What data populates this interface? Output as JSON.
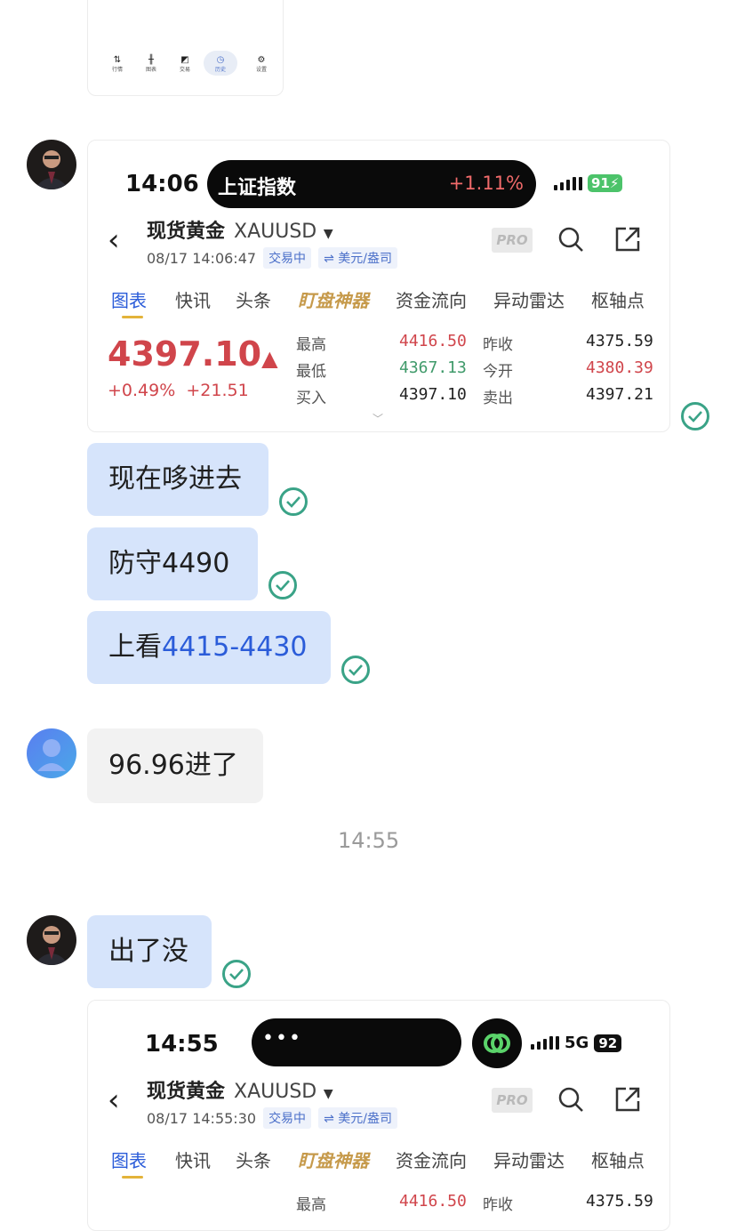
{
  "top_card": {
    "nav": [
      {
        "icon": "quotes-icon",
        "label": "行情"
      },
      {
        "icon": "candles-icon",
        "label": "图表"
      },
      {
        "icon": "trade-icon",
        "label": "交易"
      },
      {
        "icon": "history-icon",
        "label": "历史"
      },
      {
        "icon": "settings-icon",
        "label": "设置"
      }
    ]
  },
  "shot1": {
    "time": "14:06",
    "ticker_name": "上证指数",
    "ticker_change": "+1.11%",
    "battery": "91",
    "instrument": "现货黄金",
    "code": "XAUUSD",
    "datetime": "08/17 14:06:47",
    "status": "交易中",
    "currency": "⇌ 美元/盎司",
    "pro": "PRO",
    "tabs": [
      "图表",
      "快讯",
      "头条",
      "盯盘神器",
      "资金流向",
      "异动雷达",
      "枢轴点"
    ],
    "price": "4397.10",
    "change_pct": "+0.49%",
    "change_abs": "+21.51",
    "quotes": [
      {
        "label": "最高",
        "value": "4416.50",
        "label2": "昨收",
        "value2": "4375.59"
      },
      {
        "label": "最低",
        "value": "4367.13",
        "label2": "今开",
        "value2": "4380.39"
      },
      {
        "label": "买入",
        "value": "4397.10",
        "label2": "卖出",
        "value2": "4397.21"
      }
    ]
  },
  "messages": {
    "m1": "现在哆进去",
    "m2": "防守4490",
    "m3_prefix": "上看",
    "m3_range": "4415-4430",
    "m4": "96.96进了",
    "timestamp": "14:55",
    "m5": "出了没"
  },
  "shot2": {
    "time": "14:55",
    "network": "5G",
    "battery": "92",
    "instrument": "现货黄金",
    "code": "XAUUSD",
    "datetime": "08/17 14:55:30",
    "status": "交易中",
    "currency": "⇌ 美元/盎司",
    "pro": "PRO",
    "tabs": [
      "图表",
      "快讯",
      "头条",
      "盯盘神器",
      "资金流向",
      "异动雷达",
      "枢轴点"
    ],
    "quotes": [
      {
        "label": "最高",
        "value": "4416.50",
        "label2": "昨收",
        "value2": "4375.59"
      }
    ]
  },
  "colors": {
    "bubble_self": "#d6e4fb",
    "bubble_other": "#f2f2f2",
    "check": "#3aa387",
    "price_up": "#d0454b",
    "price_down": "#3f9a6a",
    "link": "#2b5cd9"
  }
}
